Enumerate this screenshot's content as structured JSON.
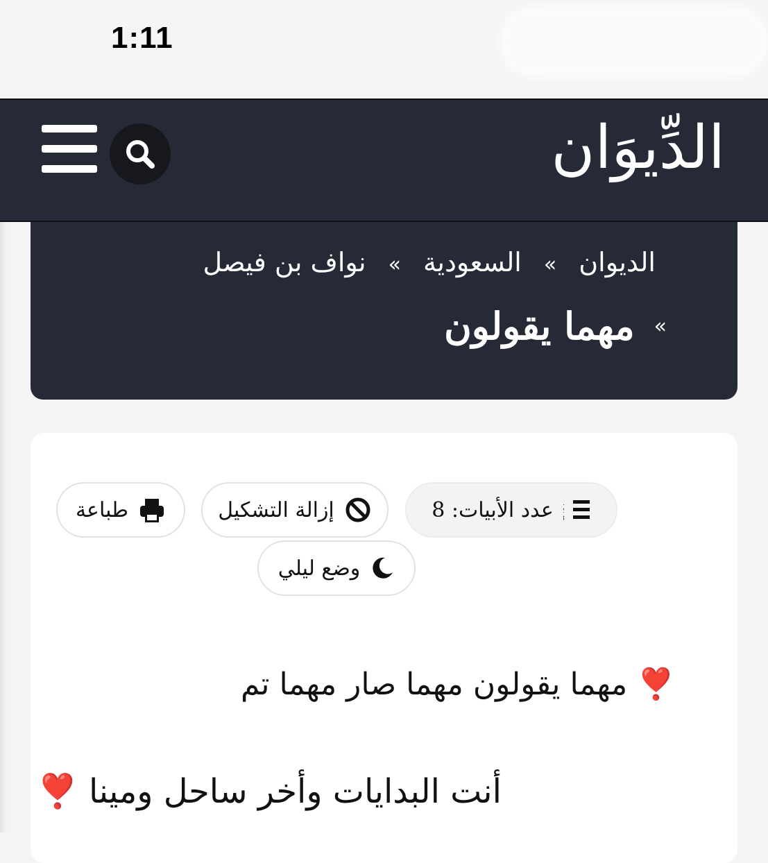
{
  "status_bar": {
    "time": "1:11"
  },
  "header": {
    "logo_text": "الدِّيوَان",
    "menu_icon": "hamburger-menu-icon",
    "search_icon": "search-icon",
    "background_color": "#262a37"
  },
  "breadcrumb": {
    "separator": "»",
    "items": [
      "الديوان",
      "السعودية",
      "نواف بن فيصل"
    ],
    "current": "مهما يقولون"
  },
  "toolbar": {
    "verse_count_label": "عدد الأبيات: 8",
    "remove_diacritics_label": "إزالة التشكيل",
    "print_label": "طباعة",
    "night_mode_label": "وضع ليلي",
    "icons": [
      "numbered-list-icon",
      "ban-icon",
      "printer-icon",
      "moon-icon"
    ]
  },
  "poem": {
    "verses": [
      {
        "text": "مهما يقولون مهما صار مهما تم",
        "emoji": "❣️"
      },
      {
        "text": "أنت البدايات وأخر ساحل ومينا",
        "emoji": "❣️"
      }
    ],
    "accent_color": "#e0142c"
  }
}
